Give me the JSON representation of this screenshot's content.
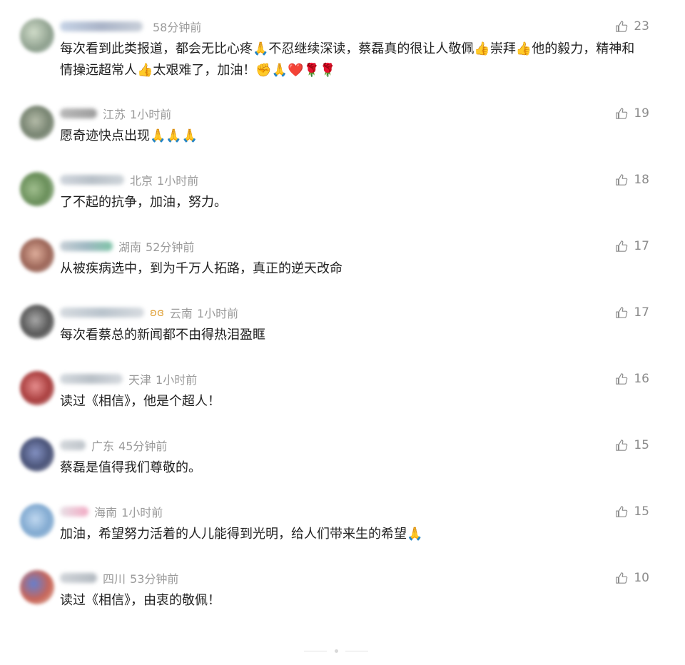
{
  "comments": [
    {
      "region": "",
      "time": "58分钟前",
      "likes": "23",
      "text": "每次看到此类报道，都会无比心疼🙏不忍继续深读，蔡磊真的很让人敬佩👍崇拜👍他的毅力，精神和情操远超常人👍太艰难了，加油！✊🙏❤️🌹🌹",
      "avatar_color": "#7a8f7a"
    },
    {
      "region": "江苏",
      "time": "1小时前",
      "likes": "19",
      "text": "愿奇迹快点出现🙏🙏🙏",
      "avatar_color": "#5f6e58"
    },
    {
      "region": "北京",
      "time": "1小时前",
      "likes": "18",
      "text": "了不起的抗争，加油，努力。",
      "avatar_color": "#4e7a3c"
    },
    {
      "region": "湖南",
      "time": "52分钟前",
      "likes": "17",
      "text": "从被疾病选中，到为千万人拓路，真正的逆天改命",
      "avatar_color": "#8a4a3a"
    },
    {
      "region": "云南",
      "time": "1小时前",
      "likes": "17",
      "text": "每次看蔡总的新闻都不由得热泪盈眶",
      "avatar_color": "#3a3a3a",
      "badge": "ʚɞ"
    },
    {
      "region": "天津",
      "time": "1小时前",
      "likes": "16",
      "text": "读过《相信》，他是个超人！",
      "avatar_color": "#9a1c1c"
    },
    {
      "region": "广东",
      "time": "45分钟前",
      "likes": "15",
      "text": "蔡磊是值得我们尊敬的。",
      "avatar_color": "#2a3560"
    },
    {
      "region": "海南",
      "time": "1小时前",
      "likes": "15",
      "text": "加油，希望努力活着的人儿能得到光明，给人们带来生的希望🙏",
      "avatar_color": "#6a9ac8"
    },
    {
      "region": "四川",
      "time": "53分钟前",
      "likes": "10",
      "text": "读过《相信》，由衷的敬佩！",
      "avatar_color": "#c04a3a"
    }
  ]
}
